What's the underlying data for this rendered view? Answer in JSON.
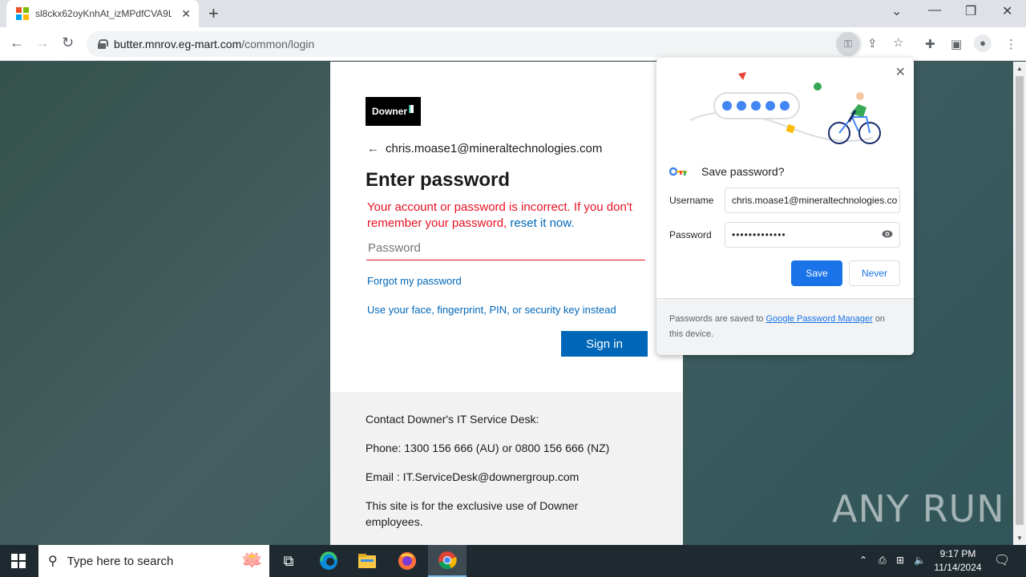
{
  "browser": {
    "tab_title": "sl8ckx62oyKnhAt_izMPdfCVA9L",
    "new_tab_symbol": "+",
    "url_host": "butter.mnrov.eg-mart.com",
    "url_path": "/common/login"
  },
  "login": {
    "brand": "Downer",
    "email": "chris.moase1@mineraltechnologies.com",
    "heading": "Enter password",
    "error_text": "Your account or password is incorrect. If you don't remember your password,",
    "error_link": "reset it now.",
    "password_placeholder": "Password",
    "forgot_link": "Forgot my password",
    "alt_signin_link": "Use your face, fingerprint, PIN, or security key instead",
    "signin_button": "Sign in"
  },
  "footer": {
    "contact": "Contact Downer's IT Service Desk:",
    "phone": "Phone: 1300 156 666 (AU) or 0800 156 666 (NZ)",
    "email": "Email : IT.ServiceDesk@downergroup.com",
    "notice": "This site is for the exclusive use of Downer employees."
  },
  "save_password": {
    "title": "Save password?",
    "username_label": "Username",
    "username_value": "chris.moase1@mineraltechnologies.co",
    "password_label": "Password",
    "password_value": "•••••••••••••",
    "save_button": "Save",
    "never_button": "Never",
    "footer_prefix": "Passwords are saved to",
    "footer_link": "Google Password Manager",
    "footer_suffix": "on this device."
  },
  "watermark": "ANY RUN",
  "taskbar": {
    "search_placeholder": "Type here to search",
    "time": "9:17 PM",
    "date": "11/14/2024"
  },
  "colors": {
    "ms_blue": "#0067b8",
    "error_red": "#e81123",
    "chrome_blue": "#1a73e8"
  }
}
